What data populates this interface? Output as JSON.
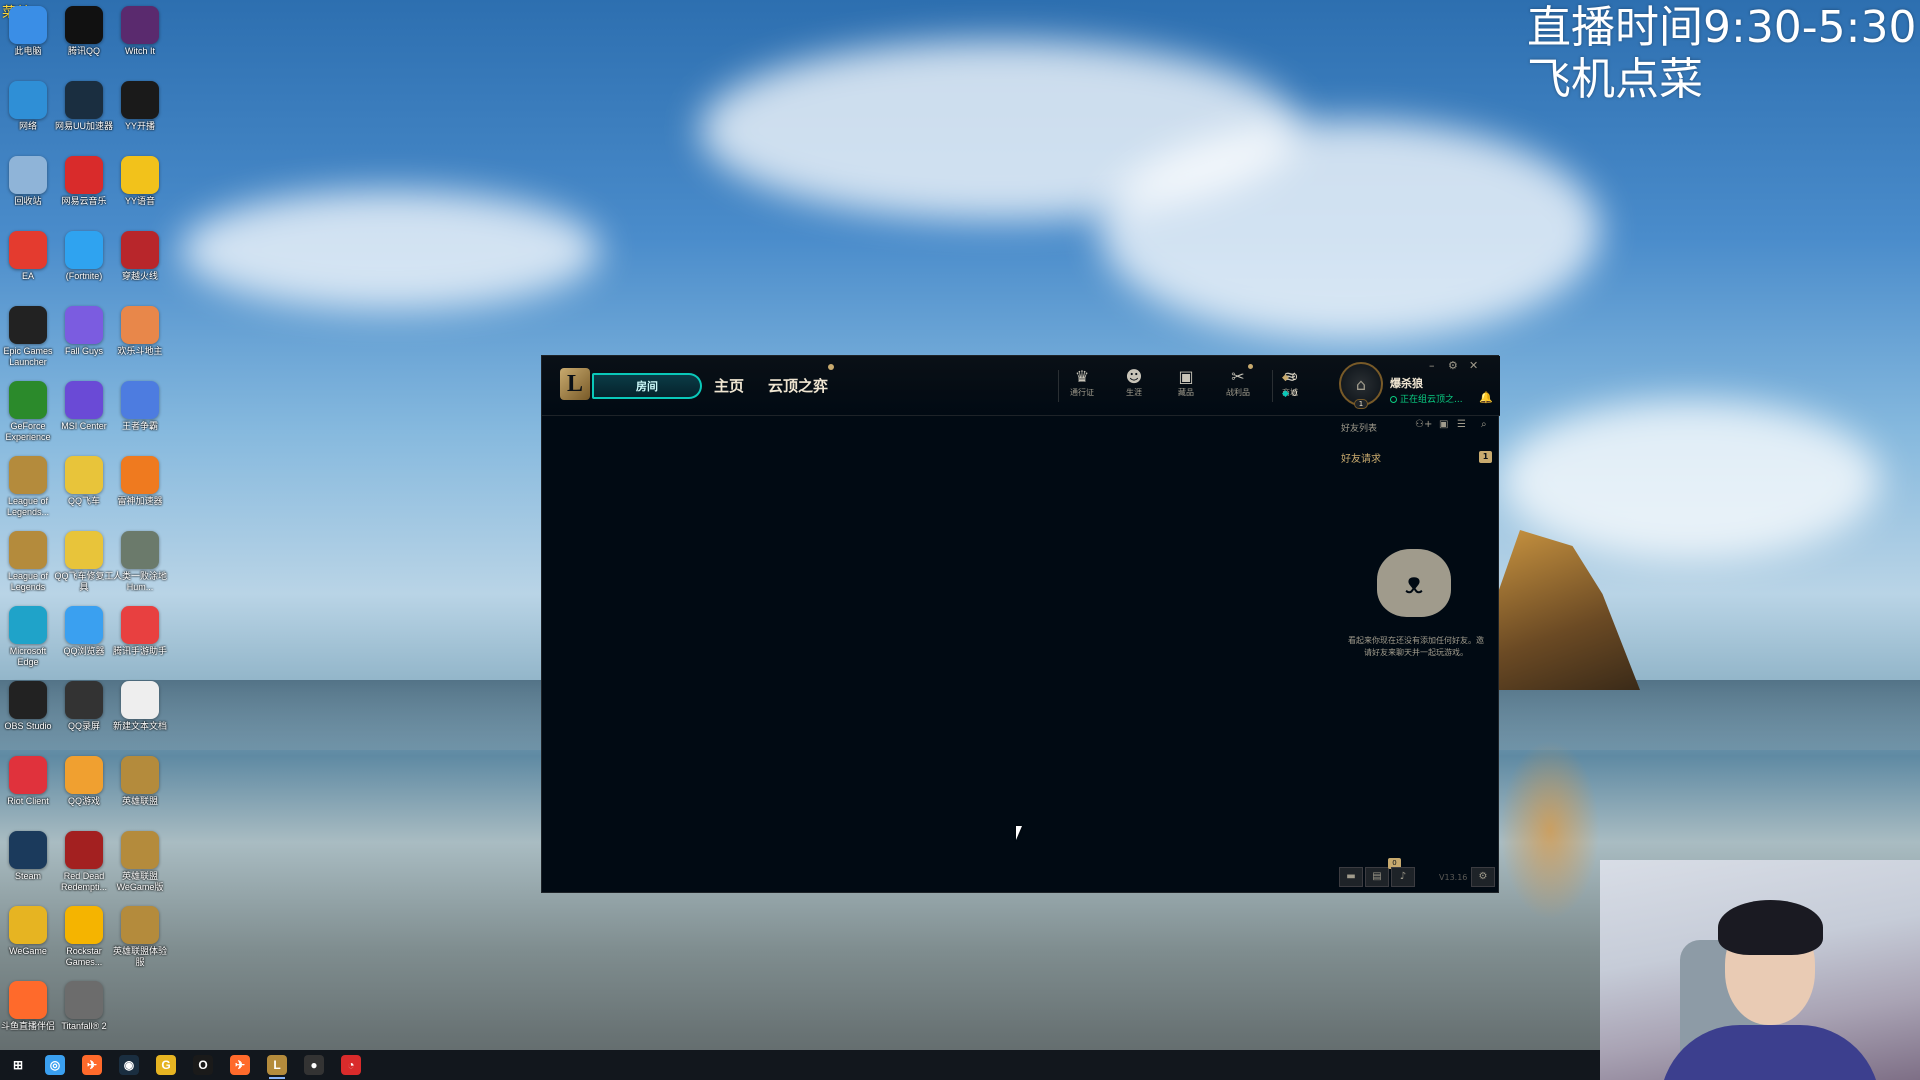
{
  "overlay": {
    "corner_label": "菜单",
    "stream_line1": "直播时间9:30-5:30",
    "stream_line2": "飞机点菜"
  },
  "desktop_icons": [
    {
      "label": "此电脑",
      "icon": "computer-icon",
      "color": "#3a8ee6"
    },
    {
      "label": "腾讯QQ",
      "icon": "qq-icon",
      "color": "#111111"
    },
    {
      "label": "Witch It",
      "icon": "witch-it-icon",
      "color": "#5a2a6e"
    },
    {
      "label": "网络",
      "icon": "network-icon",
      "color": "#2f8fd6"
    },
    {
      "label": "网易UU加速器",
      "icon": "uu-accelerator-icon",
      "color": "#1a2e40"
    },
    {
      "label": "YY开播",
      "icon": "yy-live-icon",
      "color": "#1a1a1a"
    },
    {
      "label": "回收站",
      "icon": "recycle-bin-icon",
      "color": "#8fb4d8"
    },
    {
      "label": "网易云音乐",
      "icon": "netease-music-icon",
      "color": "#d92b2b"
    },
    {
      "label": "YY语音",
      "icon": "yy-voice-icon",
      "color": "#f2c21b"
    },
    {
      "label": "EA",
      "icon": "ea-icon",
      "color": "#e43b2f"
    },
    {
      "label": "(Fortnite)",
      "icon": "fortnite-icon",
      "color": "#2fa3f0"
    },
    {
      "label": "穿越火线",
      "icon": "crossfire-icon",
      "color": "#b8262b"
    },
    {
      "label": "Epic Games Launcher",
      "icon": "epic-games-icon",
      "color": "#222222"
    },
    {
      "label": "Fall Guys",
      "icon": "fall-guys-icon",
      "color": "#7b5ce0"
    },
    {
      "label": "欢乐斗地主",
      "icon": "doudizhu-icon",
      "color": "#e8874a"
    },
    {
      "label": "GeForce Experience",
      "icon": "geforce-icon",
      "color": "#2b8a2b"
    },
    {
      "label": "MSI Center",
      "icon": "msi-center-icon",
      "color": "#6a4ad6"
    },
    {
      "label": "王者争霸",
      "icon": "game-icon",
      "color": "#4d7ce0"
    },
    {
      "label": "League of Legends...",
      "icon": "league-of-legends-icon",
      "color": "#b48b3c"
    },
    {
      "label": "QQ飞车",
      "icon": "qq-speed-icon",
      "color": "#e8c43a"
    },
    {
      "label": "雷神加速器",
      "icon": "leishen-icon",
      "color": "#ef7a1f"
    },
    {
      "label": "League of Legends",
      "icon": "league-of-legends-icon",
      "color": "#b48b3c"
    },
    {
      "label": "QQ飞车修复工具",
      "icon": "qq-speed-repair-icon",
      "color": "#e8c43a"
    },
    {
      "label": "人类一败涂地 Hum...",
      "icon": "human-fall-flat-icon",
      "color": "#6b7a6b"
    },
    {
      "label": "Microsoft Edge",
      "icon": "edge-icon",
      "color": "#1fa3c9"
    },
    {
      "label": "QQ浏览器",
      "icon": "qq-browser-icon",
      "color": "#3aa0f0"
    },
    {
      "label": "腾讯手游助手",
      "icon": "tencent-mobile-icon",
      "color": "#e84040"
    },
    {
      "label": "OBS Studio",
      "icon": "obs-icon",
      "color": "#222222"
    },
    {
      "label": "QQ录屏",
      "icon": "qq-record-icon",
      "color": "#333333"
    },
    {
      "label": "新建文本文档",
      "icon": "text-document-icon",
      "color": "#eeeeee"
    },
    {
      "label": "Riot Client",
      "icon": "riot-client-icon",
      "color": "#e0323c"
    },
    {
      "label": "QQ游戏",
      "icon": "qq-game-icon",
      "color": "#f0a030"
    },
    {
      "label": "英雄联盟",
      "icon": "league-of-legends-icon",
      "color": "#b48b3c"
    },
    {
      "label": "Steam",
      "icon": "steam-icon",
      "color": "#1b3a5c"
    },
    {
      "label": "Red Dead Redempti...",
      "icon": "red-dead-icon",
      "color": "#a32020"
    },
    {
      "label": "英雄联盟 WeGame版",
      "icon": "league-of-legends-icon",
      "color": "#b48b3c"
    },
    {
      "label": "WeGame",
      "icon": "wegame-icon",
      "color": "#e6b422"
    },
    {
      "label": "Rockstar Games...",
      "icon": "rockstar-icon",
      "color": "#f5b400"
    },
    {
      "label": "英雄联盟体验服",
      "icon": "league-of-legends-icon",
      "color": "#b48b3c"
    },
    {
      "label": "斗鱼直播伴侣",
      "icon": "douyu-icon",
      "color": "#ff6a2b"
    },
    {
      "label": "Titanfall® 2",
      "icon": "titanfall-icon",
      "color": "#6c6c6c"
    }
  ],
  "client": {
    "logo": "L",
    "play_button": "房间",
    "nav_home": "主页",
    "nav_tft": "云顶之弈",
    "tools": [
      {
        "label": "通行证",
        "icon": "pass-icon",
        "glyph": "♛"
      },
      {
        "label": "生涯",
        "icon": "profile-icon",
        "glyph": "☻"
      },
      {
        "label": "藏品",
        "icon": "collection-icon",
        "glyph": "▣"
      },
      {
        "label": "战利品",
        "icon": "loot-icon",
        "glyph": "✂"
      },
      {
        "label": "商城",
        "icon": "store-icon",
        "glyph": "≋"
      }
    ],
    "currency_be": "0",
    "currency_rp": "0",
    "player_level": "1",
    "player_name": "爆杀狼",
    "player_status": "正在组云顶之...",
    "friends_header": "好友列表",
    "friend_requests_label": "好友请求",
    "friend_requests_count": "1",
    "empty_message": "看起来你现在还没有添加任何好友。邀请好友来聊天并一起玩游戏。",
    "notification_count": "0",
    "version": "V13.16",
    "accent_gold": "#c8aa6e",
    "accent_teal": "#0ac8b9"
  },
  "taskbar": [
    {
      "icon": "windows-start-icon",
      "glyph": "⊞",
      "color": "#12171d"
    },
    {
      "icon": "qq-browser-icon",
      "glyph": "◎",
      "color": "#3aa0f0"
    },
    {
      "icon": "douyu-icon",
      "glyph": "✈",
      "color": "#ff6a2b"
    },
    {
      "icon": "uu-accelerator-icon",
      "glyph": "◉",
      "color": "#1a2e40"
    },
    {
      "icon": "wegame-icon",
      "glyph": "G",
      "color": "#e6b422"
    },
    {
      "icon": "yy-live-icon",
      "glyph": "O",
      "color": "#1a1a1a"
    },
    {
      "icon": "douyu-live-icon",
      "glyph": "✈",
      "color": "#ff6a2b"
    },
    {
      "icon": "league-of-legends-icon",
      "glyph": "L",
      "color": "#b48b3c"
    },
    {
      "icon": "obs-icon",
      "glyph": "●",
      "color": "#333333"
    },
    {
      "icon": "netease-music-icon",
      "glyph": "◔",
      "color": "#d92b2b"
    }
  ]
}
